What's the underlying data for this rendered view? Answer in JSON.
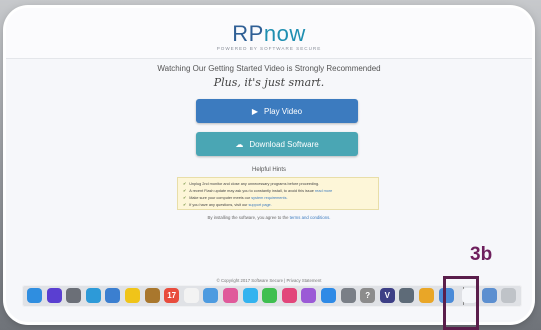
{
  "header": {
    "logo_rp": "RP",
    "logo_now": "now",
    "powered_by": "POWERED BY SOFTWARE SECURE"
  },
  "main": {
    "headline": "Watching Our Getting Started Video is Strongly Recommended",
    "tagline": "Plus, it's just smart.",
    "play_button": "Play Video",
    "download_button": "Download Software"
  },
  "hints": {
    "title": "Helpful Hints",
    "items": [
      {
        "text": "Unplug 2nd monitor and close any unnecessary programs before proceeding.",
        "link": ""
      },
      {
        "text": "A recent Flash update may ask you to constantly install, to avoid this issue ",
        "link": "read more"
      },
      {
        "text": "Make sure your computer meets our ",
        "link": "system requirements."
      },
      {
        "text": "If you have any questions, visit our ",
        "link": "support page."
      }
    ]
  },
  "agreement": {
    "text": "By installing the software, you agree to the ",
    "link": "terms and conditions."
  },
  "footer": {
    "copyright": "© Copyright 2017 Software Secure | Privacy Statement"
  },
  "annotation": {
    "label": "3b"
  },
  "dock": {
    "icons": [
      {
        "name": "finder-icon",
        "color": "#2f8ee0",
        "glyph": ""
      },
      {
        "name": "siri-icon",
        "color": "#5a3fd1",
        "glyph": ""
      },
      {
        "name": "launchpad-icon",
        "color": "#6b6f77",
        "glyph": ""
      },
      {
        "name": "safari-icon",
        "color": "#2d9ad8",
        "glyph": ""
      },
      {
        "name": "mail-icon",
        "color": "#3b7fd0",
        "glyph": ""
      },
      {
        "name": "notes-icon",
        "color": "#f0c419",
        "glyph": ""
      },
      {
        "name": "contacts-icon",
        "color": "#a9772d",
        "glyph": ""
      },
      {
        "name": "calendar-icon",
        "color": "#e84c3d",
        "glyph": "17"
      },
      {
        "name": "reminders-icon",
        "color": "#f3f3f3",
        "glyph": ""
      },
      {
        "name": "preview-icon",
        "color": "#4d9be0",
        "glyph": ""
      },
      {
        "name": "photos-icon",
        "color": "#e05a9b",
        "glyph": ""
      },
      {
        "name": "messages-icon",
        "color": "#33b3ef",
        "glyph": ""
      },
      {
        "name": "facetime-icon",
        "color": "#3fbf50",
        "glyph": ""
      },
      {
        "name": "itunes-icon",
        "color": "#e2467b",
        "glyph": ""
      },
      {
        "name": "itunes-store-icon",
        "color": "#9b5ad6",
        "glyph": ""
      },
      {
        "name": "app-store-icon",
        "color": "#2e8ae6",
        "glyph": ""
      },
      {
        "name": "system-preferences-icon",
        "color": "#7a7f87",
        "glyph": ""
      },
      {
        "name": "help-icon",
        "color": "#8c8c8c",
        "glyph": "?"
      },
      {
        "name": "vmware-icon",
        "color": "#3d3f86",
        "glyph": "V"
      },
      {
        "name": "image-capture-icon",
        "color": "#5e6b78",
        "glyph": ""
      },
      {
        "name": "chrome-icon",
        "color": "#e9a627",
        "glyph": ""
      },
      {
        "name": "screenshot-icon",
        "color": "#4b8bd8",
        "glyph": ""
      },
      {
        "name": "rpnow-installer-icon",
        "color": "#f5f7fa",
        "glyph": ""
      },
      {
        "name": "downloads-icon",
        "color": "#5c8fd0",
        "glyph": ""
      },
      {
        "name": "trash-icon",
        "color": "#bfc3c8",
        "glyph": ""
      }
    ]
  }
}
